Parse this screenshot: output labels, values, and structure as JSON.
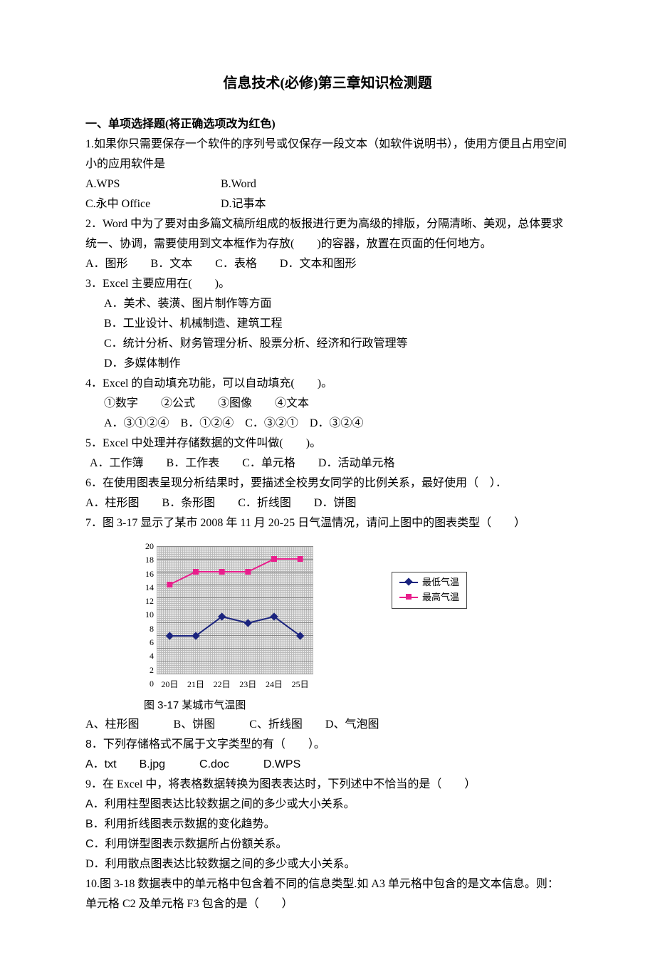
{
  "title": "信息技术(必修)第三章知识检测题",
  "section1": "一、单项选择题(将正确选项改为红色)",
  "q1": {
    "text": "1.如果你只需要保存一个软件的序列号或仅保存一段文本（如软件说明书），使用方便且占用空间小的应用软件是",
    "a": "A.WPS",
    "b": "B.Word",
    "c": "C.永中 Office",
    "d": "D.记事本"
  },
  "q2": {
    "text": "2．Word 中为了要对由多篇文稿所组成的板报进行更为高级的排版，分隔清晰、美观，总体要求统一、协调，需要使用到文本框作为存放(　　)的容器，放置在页面的任何地方。",
    "opts": "A．图形　　B．文本　　C．表格　　D．文本和图形"
  },
  "q3": {
    "text": "3．Excel 主要应用在(　　)。",
    "a": "A．美术、装潢、图片制作等方面",
    "b": "B．工业设计、机械制造、建筑工程",
    "c": "C．统计分析、财务管理分析、股票分析、经济和行政管理等",
    "d": "D．多媒体制作"
  },
  "q4": {
    "text": "4．Excel 的自动填充功能，可以自动填充(　　)。",
    "line1": "①数字　　②公式　　③图像　　④文本",
    "line2": "A．③①②④　B．①②④　C．③②①　D．③②④"
  },
  "q5": {
    "text": "5．Excel 中处理并存储数据的文件叫做(　　)。",
    "opts": "A．工作簿　　B．工作表　　C．单元格　　D．活动单元格"
  },
  "q6": {
    "text": "6．在使用图表呈现分析结果时，要描述全校男女同学的比例关系，最好使用（　）．",
    "opts": "A．柱形图　　B．条形图　　C．折线图　　D．饼图"
  },
  "q7": {
    "text": "7．图 3-17 显示了某市 2008 年 11 月 20-25 日气温情况，请问上图中的图表类型（　　）",
    "caption": "图 3-17 某城市气温图",
    "opts": "A、柱形图　　　B、饼图　　　C、折线图　　D、气泡图"
  },
  "q8": {
    "text": "8．下列存储格式不属于文字类型的有（　　）。",
    "opts": "A．txt　　B.jpg　　　C.doc　　　D.WPS"
  },
  "q9": {
    "text": "9．在 Excel 中，将表格数据转换为图表表达时，下列述中不恰当的是（　　）",
    "a": "A．利用柱型图表达比较数据之间的多少或大小关系。",
    "b": "B．利用折线图表示数据的变化趋势。",
    "c": "C．利用饼型图表示数据所占份额关系。",
    "d": "D．利用散点图表达比较数据之间的多少或大小关系。"
  },
  "q10": {
    "text": "10.图 3-18 数据表中的单元格中包含着不同的信息类型.如 A3 单元格中包含的是文本信息。则：单元格 C2 及单元格 F3 包含的是（　　）"
  },
  "chart_data": {
    "type": "line",
    "categories": [
      "20日",
      "21日",
      "22日",
      "23日",
      "24日",
      "25日"
    ],
    "series": [
      {
        "name": "最低气温",
        "color": "#1a237e",
        "marker": "diamond",
        "values": [
          6,
          6,
          9,
          8,
          9,
          6
        ]
      },
      {
        "name": "最高气温",
        "color": "#e91e8c",
        "marker": "square",
        "values": [
          14,
          16,
          16,
          16,
          18,
          18
        ]
      }
    ],
    "yticks": [
      0,
      2,
      4,
      6,
      8,
      10,
      12,
      14,
      16,
      18,
      20
    ],
    "ylim": [
      0,
      20
    ]
  }
}
